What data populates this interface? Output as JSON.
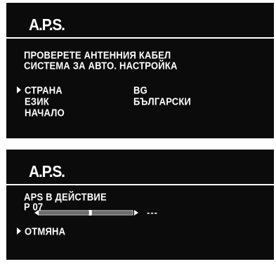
{
  "screen1": {
    "title": "A.P.S.",
    "line1": "ПРОВЕРЕТЕ  АНТЕННИЯ  КАБЕЛ",
    "line2": "СИСТЕМА  ЗА  АВТО.  НАСТРОЙКА",
    "menu": [
      {
        "label": "СТРАНА",
        "value": "BG",
        "selected": true
      },
      {
        "label": "ЕЗИК",
        "value": "БЪЛГАРСКИ",
        "selected": false
      },
      {
        "label": "НАЧАЛО",
        "value": "",
        "selected": false
      }
    ]
  },
  "screen2": {
    "title": "A.P.S.",
    "status": "APS В ДЕЙСТВИЕ",
    "program": "P 07",
    "progress": 0.55,
    "frequency": "---",
    "cancel_label": "ОТМЯНА"
  },
  "colors": {
    "panel": "#0b0b0b",
    "text": "#ffffff",
    "page": "#ffffff"
  }
}
